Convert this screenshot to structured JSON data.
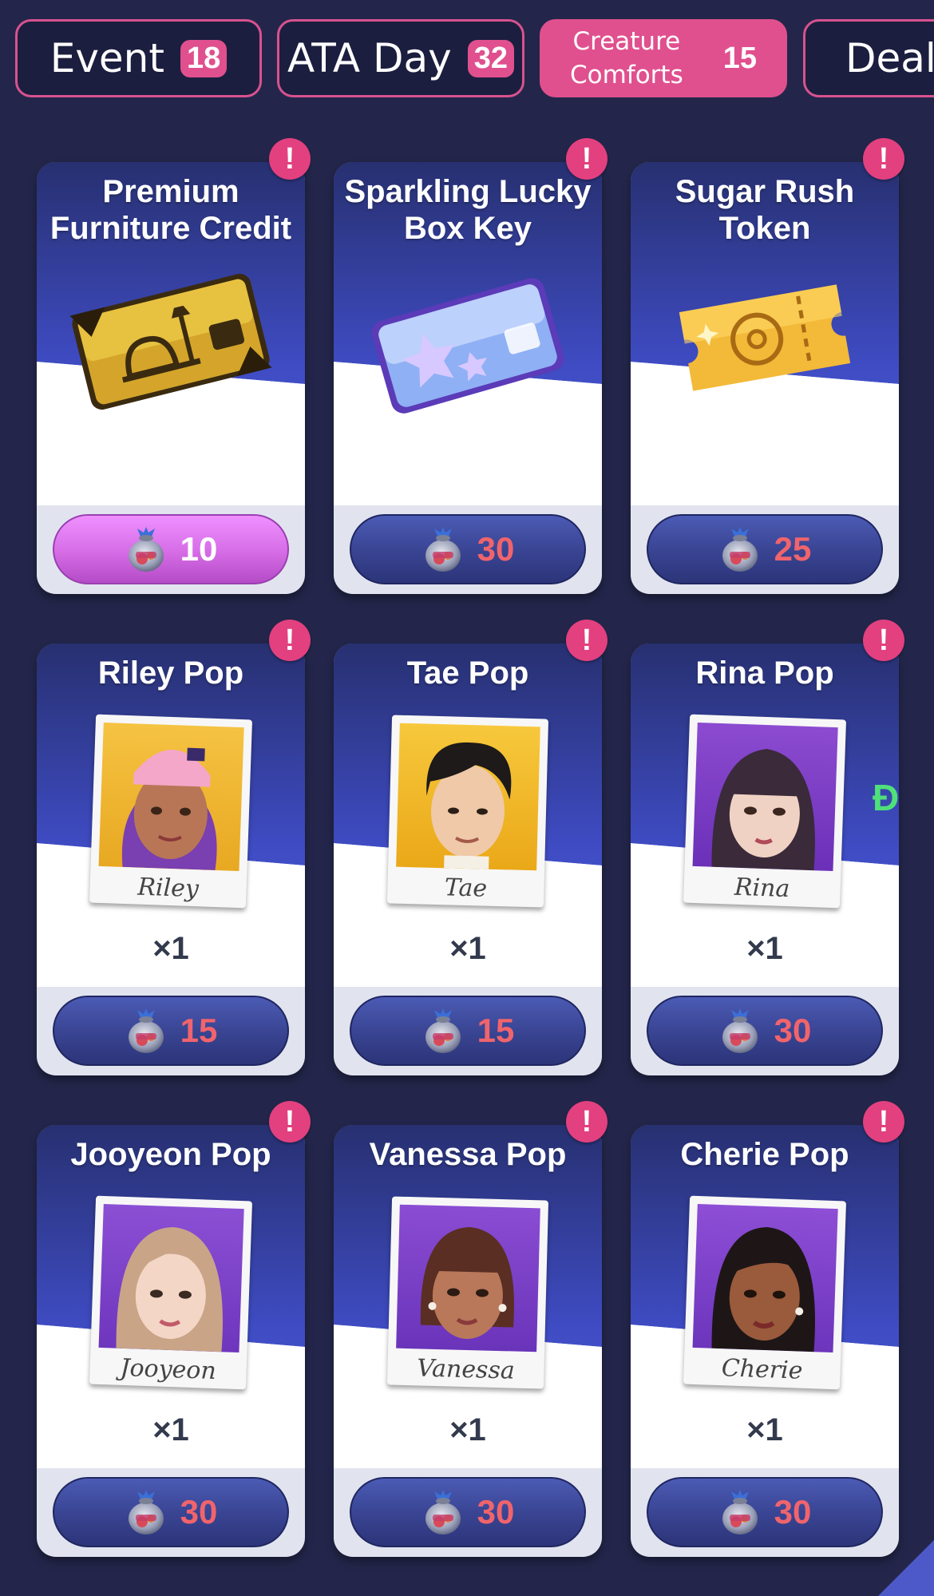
{
  "tabs": [
    {
      "label": "Event",
      "badge": "18"
    },
    {
      "label": "ATA Day",
      "badge": "32"
    },
    {
      "label": "Creature\nComforts",
      "badge": "15"
    },
    {
      "label": "Deal",
      "badge": ""
    }
  ],
  "cards": [
    {
      "title": "Premium Furniture Credit",
      "art": "furniture-credit-card-icon",
      "price": "10"
    },
    {
      "title": "Sparkling Lucky Box Key",
      "art": "lucky-box-key-card-icon",
      "price": "30"
    },
    {
      "title": "Sugar Rush Token",
      "art": "sugar-rush-ticket-icon",
      "price": "25"
    },
    {
      "title": "Riley Pop",
      "caption": "Riley",
      "qty": "×1",
      "price": "15"
    },
    {
      "title": "Tae Pop",
      "caption": "Tae",
      "qty": "×1",
      "price": "15"
    },
    {
      "title": "Rina Pop",
      "caption": "Rina",
      "qty": "×1",
      "price": "30"
    },
    {
      "title": "Jooyeon Pop",
      "caption": "Jooyeon",
      "qty": "×1",
      "price": "30"
    },
    {
      "title": "Vanessa Pop",
      "caption": "Vanessa",
      "qty": "×1",
      "price": "30"
    },
    {
      "title": "Cherie Pop",
      "caption": "Cherie",
      "qty": "×1",
      "price": "30"
    }
  ],
  "alert_symbol": "!",
  "side_glyph": "Đ",
  "currency_icon": "candy-bag-icon",
  "colors": {
    "accent_pink": "#e0508e",
    "price_red": "#f0646c",
    "card_blue": "#4a5bd6",
    "background": "#23264a"
  }
}
